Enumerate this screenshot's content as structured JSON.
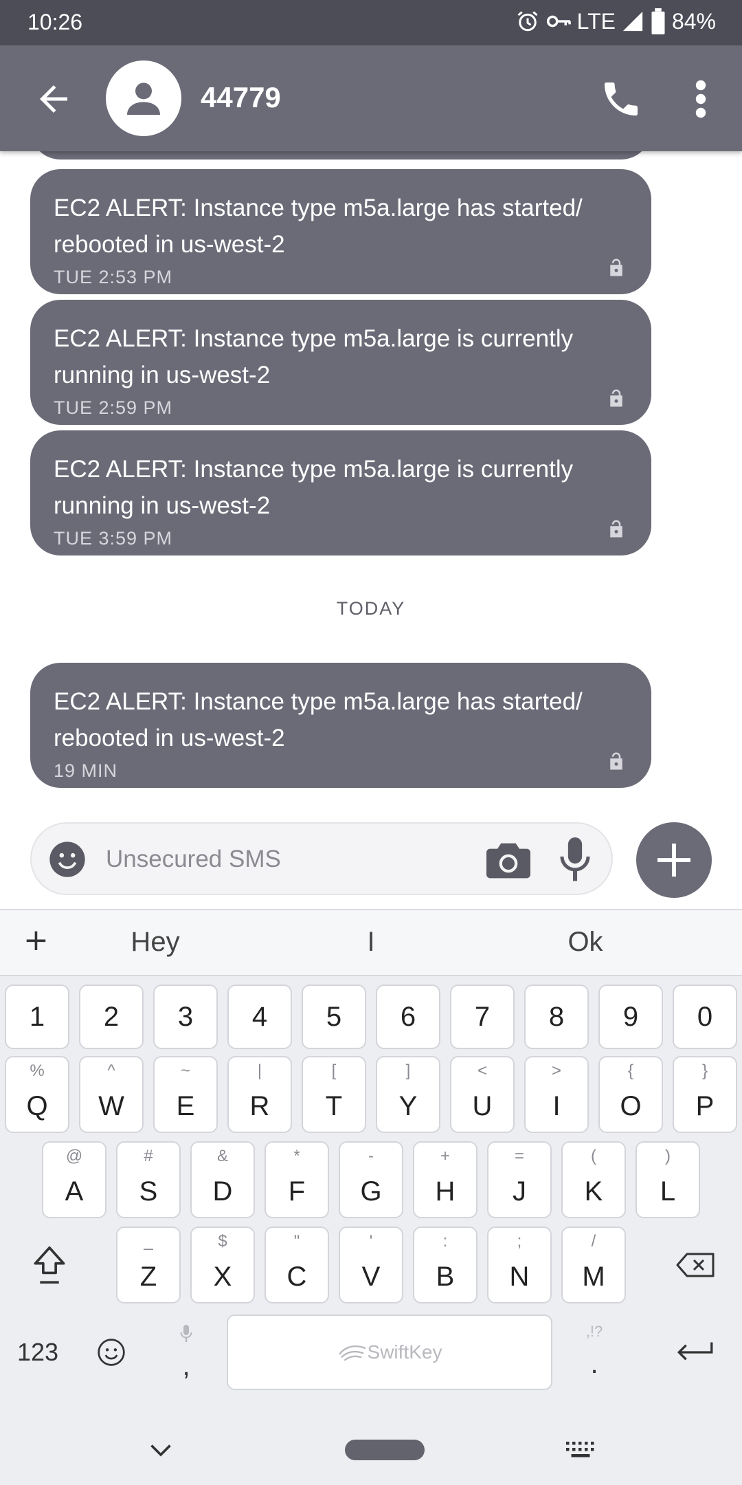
{
  "status_bar": {
    "time": "10:26",
    "network": "LTE",
    "battery": "84%"
  },
  "header": {
    "contact": "44779"
  },
  "messages": [
    {
      "text": "EC2 ALERT: Instance type m5a.large has started/ rebooted in us-west-2",
      "line1": "EC2 ALERT: Instance type m5a.large has started/",
      "line2": "rebooted in us-west-2",
      "time": "TUE 2:53 PM"
    },
    {
      "text": "EC2 ALERT: Instance type m5a.large is currently running in us-west-2",
      "line1": "EC2 ALERT: Instance type m5a.large is currently",
      "line2": "running in us-west-2",
      "time": "TUE 2:59 PM"
    },
    {
      "text": "EC2 ALERT: Instance type m5a.large is currently running in us-west-2",
      "line1": "EC2 ALERT: Instance type m5a.large is currently",
      "line2": "running in us-west-2",
      "time": "TUE 3:59 PM"
    },
    {
      "text": "EC2 ALERT: Instance type m5a.large has started/ rebooted in us-west-2",
      "line1": "EC2 ALERT: Instance type m5a.large has started/",
      "line2": "rebooted in us-west-2",
      "time": "19 MIN"
    }
  ],
  "date_divider": "TODAY",
  "compose": {
    "placeholder": "Unsecured SMS"
  },
  "keyboard": {
    "suggestions": [
      "Hey",
      "I",
      "Ok"
    ],
    "expand_symbol": "+",
    "numbers": [
      "1",
      "2",
      "3",
      "4",
      "5",
      "6",
      "7",
      "8",
      "9",
      "0"
    ],
    "row1": [
      {
        "key": "Q",
        "alt": "%"
      },
      {
        "key": "W",
        "alt": "^"
      },
      {
        "key": "E",
        "alt": "~"
      },
      {
        "key": "R",
        "alt": "|"
      },
      {
        "key": "T",
        "alt": "["
      },
      {
        "key": "Y",
        "alt": "]"
      },
      {
        "key": "U",
        "alt": "<"
      },
      {
        "key": "I",
        "alt": ">"
      },
      {
        "key": "O",
        "alt": "{"
      },
      {
        "key": "P",
        "alt": "}"
      }
    ],
    "row2": [
      {
        "key": "A",
        "alt": "@"
      },
      {
        "key": "S",
        "alt": "#"
      },
      {
        "key": "D",
        "alt": "&"
      },
      {
        "key": "F",
        "alt": "*"
      },
      {
        "key": "G",
        "alt": "-"
      },
      {
        "key": "H",
        "alt": "+"
      },
      {
        "key": "J",
        "alt": "="
      },
      {
        "key": "K",
        "alt": "("
      },
      {
        "key": "L",
        "alt": ")"
      }
    ],
    "row3": [
      {
        "key": "Z",
        "alt": "_"
      },
      {
        "key": "X",
        "alt": "$"
      },
      {
        "key": "C",
        "alt": "\""
      },
      {
        "key": "V",
        "alt": "'"
      },
      {
        "key": "B",
        "alt": ":"
      },
      {
        "key": "N",
        "alt": ";"
      },
      {
        "key": "M",
        "alt": "/"
      }
    ],
    "symbols_key": "123",
    "comma": ",",
    "period": ".",
    "period_alt": ",!?",
    "space_brand": "SwiftKey"
  },
  "colors": {
    "status_bar": "#4d4d58",
    "app_bar": "#6b6b78",
    "bubble": "#6b6b78",
    "keyboard_bg": "#eceef2"
  },
  "icons": {
    "back": "arrow-back",
    "avatar": "person",
    "call": "phone",
    "more": "more-vertical",
    "lock": "lock-open",
    "emoji": "smiley",
    "camera": "camera",
    "mic": "microphone",
    "add": "plus"
  }
}
